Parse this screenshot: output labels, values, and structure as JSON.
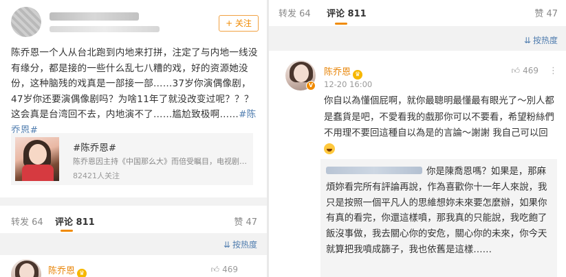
{
  "left": {
    "follow_label": "+ 关注",
    "post_text": "陈乔恩一个人从台北跑到内地来打拼，注定了与内地一线没有缘分，都是接的一些什么乱七八糟的戏，好的资源她没份，这种脑残的戏真是一部接一部……37岁你演偶像剧，47岁你还要演偶像剧吗？为啥11年了就没改变过呢？？？这会真是台湾回不去，内地演不了……尴尬致极啊……",
    "post_hashtag": "#陈乔恩#",
    "topic": {
      "title": "#陈乔恩#",
      "desc": "陈乔恩因主持《中国那么大》而倍受瞩目，电视剧…",
      "followers": "82421人关注"
    },
    "tabs": {
      "repost": "转发 64",
      "comments": "评论 811",
      "likes": "赞 47"
    },
    "sort_label": "按热度",
    "preview_comment": {
      "name": "陈乔恩",
      "likes": "469"
    }
  },
  "right": {
    "tabs": {
      "repost": "转发 64",
      "comments": "评论 811",
      "likes": "赞 47"
    },
    "sort_label": "按热度",
    "comment": {
      "name": "陈乔恩",
      "likes": "469",
      "time": "12-20 16:00",
      "text": "你自以為懂個屁啊，就你最聰明最懂最有眼光了～別人都是蠢貨是吧，不愛看我的戲那你可以不要看，希望粉絲們不用理不要回這種自以為是的言論～謝謝 我自己可以回"
    },
    "reply": {
      "text": "你是陳喬恩嗎？如果是，那麻煩妳看完所有評論再說，作為喜歡你十一年人來說，我只是按照一個平凡人的思維想妳未來要怎麼辦，如果你有真的看完，你還這樣噴，那我真的只能說，我吃飽了飯沒事做，我去關心你的安危，關心你的未來，你今天就算把我噴成篩子，我也依舊是這樣……"
    }
  },
  "colors": {
    "accent_orange": "#f08a00",
    "link_blue": "#507daf",
    "name_orange": "#e8860b"
  }
}
